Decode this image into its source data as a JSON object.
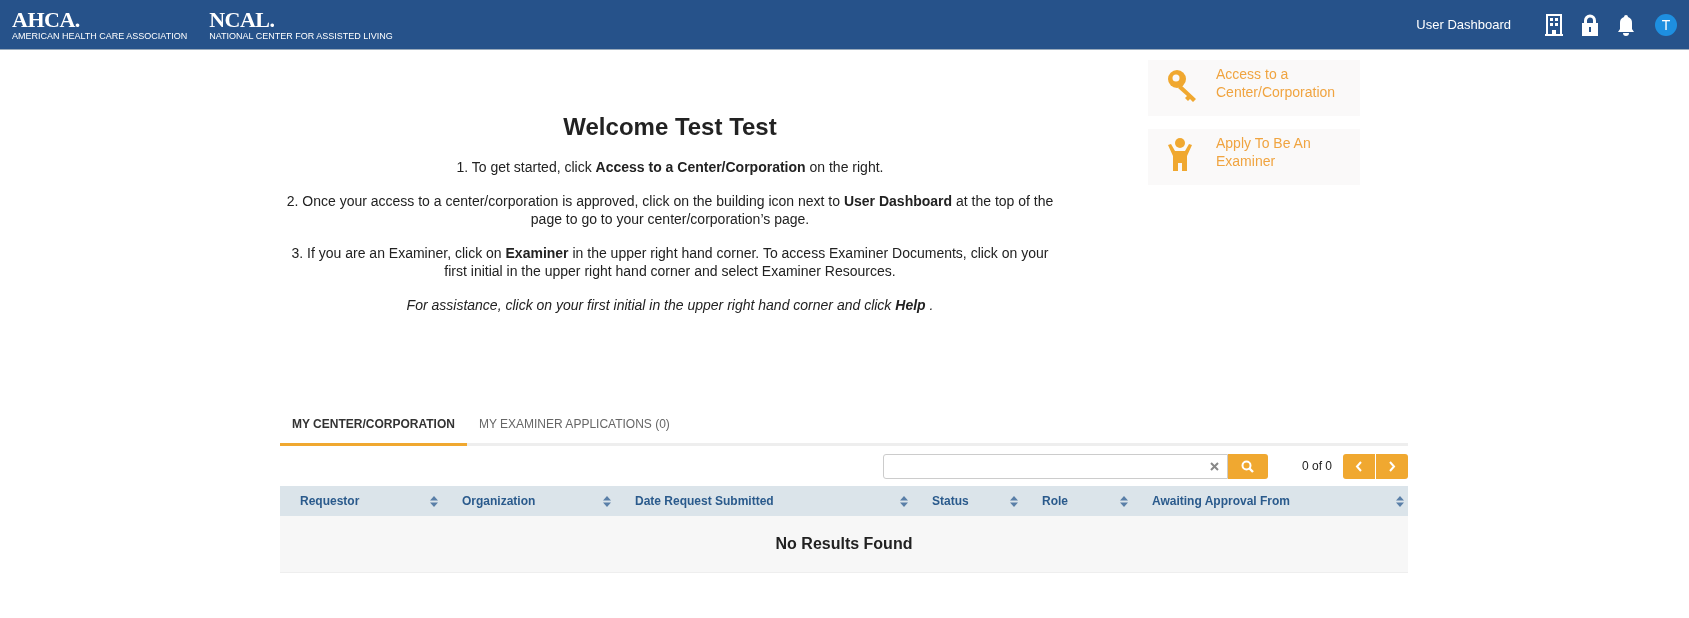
{
  "header": {
    "logos": [
      {
        "name": "AHCA.",
        "subtitle": "AMERICAN HEALTH CARE ASSOCIATION"
      },
      {
        "name": "NCAL.",
        "subtitle": "NATIONAL CENTER FOR ASSISTED LIVING"
      }
    ],
    "nav_link": "User Dashboard",
    "avatar": "T"
  },
  "welcome": {
    "title": "Welcome Test Test",
    "steps": [
      "1. To get started, click **Access to a Center/Corporation** on the right.",
      "2. Once your access to a center/corporation is approved, click on the building icon next to **User Dashboard** at the top of the page to go to your center/corporation’s page.",
      "3. If you are an Examiner, click on **Examiner** in the upper right hand corner. To access Examiner Documents, click on your first initial in the upper right hand corner and select Examiner Resources."
    ],
    "note": "For assistance, click on your first initial in the upper right hand corner and click **Help** ."
  },
  "actions": [
    {
      "kind": "key",
      "label": "Access to a Center/Corporation"
    },
    {
      "kind": "person",
      "label": "Apply To Be An Examiner"
    }
  ],
  "tabs": [
    {
      "label": "MY CENTER/CORPORATION",
      "selected": true
    },
    {
      "label": "MY EXAMINER APPLICATIONS (0)",
      "selected": false
    }
  ],
  "pager": {
    "count": "0 of 0"
  },
  "table": {
    "columns": [
      "Requestor",
      "Organization",
      "Date Request Submitted",
      "Status",
      "Role",
      "Awaiting Approval From"
    ],
    "empty_message": "No Results Found"
  }
}
